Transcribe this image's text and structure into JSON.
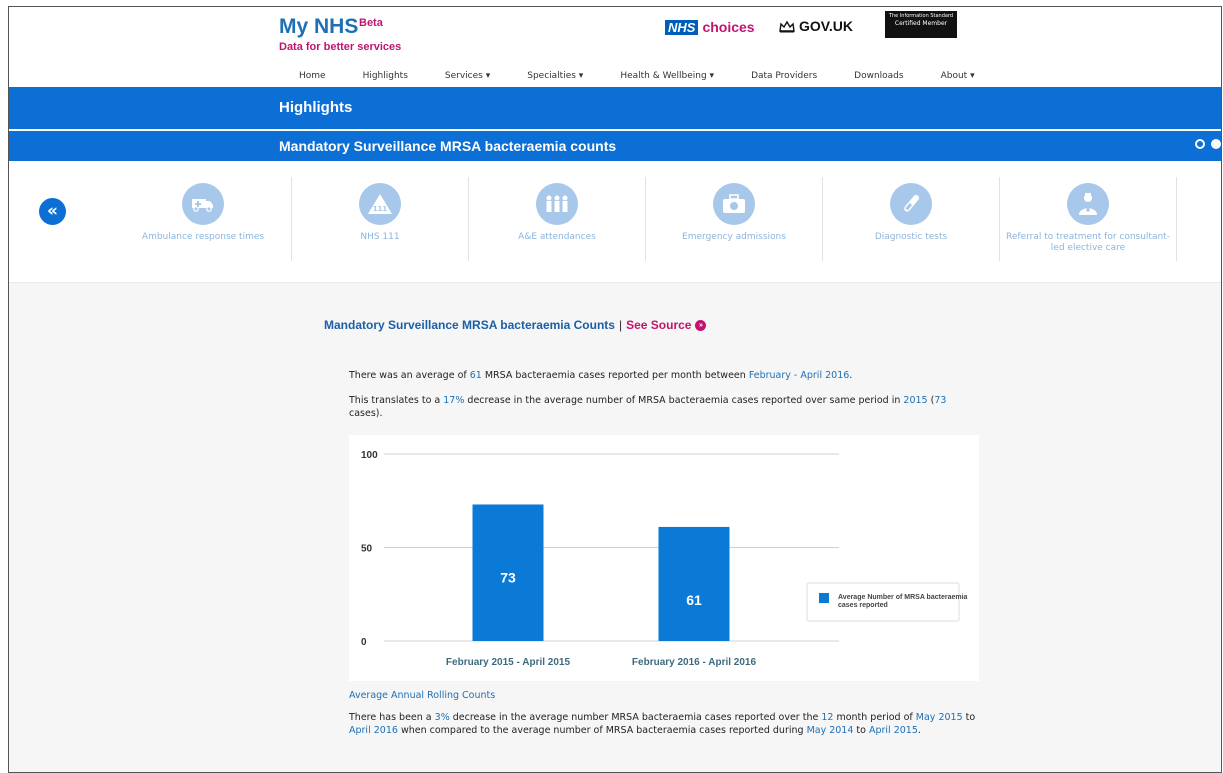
{
  "header": {
    "brand_title": "My NHS",
    "brand_beta": "Beta",
    "brand_subtitle": "Data for better services",
    "partners": {
      "nhs_box": "NHS",
      "nhs_choices": "choices",
      "gov": "GOV.UK",
      "info_standard_line1": "The Information Standard",
      "info_standard_line2": "Certified Member"
    }
  },
  "nav": {
    "items": [
      "Home",
      "Highlights",
      "Services ▾",
      "Specialties ▾",
      "Health & Wellbeing ▾",
      "Data Providers",
      "Downloads",
      "About ▾"
    ]
  },
  "highlights_bar": {
    "title": "Highlights"
  },
  "title_bar": {
    "title": "Mandatory Surveillance MRSA bacteraemia counts"
  },
  "carousel": {
    "items": [
      {
        "label": "Ambulance response times",
        "icon": "ambulance-icon"
      },
      {
        "label": "NHS 111",
        "icon": "nhs111-icon"
      },
      {
        "label": "A&E attendances",
        "icon": "people-icon"
      },
      {
        "label": "Emergency admissions",
        "icon": "medical-kit-icon"
      },
      {
        "label": "Diagnostic tests",
        "icon": "test-tube-icon"
      },
      {
        "label": "Referral to treatment for consultant-led elective care",
        "icon": "doctor-icon"
      }
    ]
  },
  "main": {
    "section_title": "Mandatory Surveillance MRSA bacteraemia Counts",
    "separator": "|",
    "source_link": "See Source",
    "para1": {
      "a": "There was an average of ",
      "value": "61",
      "b": " MRSA bacteraemia cases reported per month between ",
      "period": "February - April 2016",
      "c": "."
    },
    "para2": {
      "a": "This translates to a ",
      "pct": "17%",
      "b": " decrease in the average number of MRSA bacteraemia cases reported over same period in ",
      "year": "2015",
      "c": " (",
      "cases": "73",
      "d": " cases)."
    },
    "rolling_heading": "Average Annual Rolling Counts",
    "para4": {
      "a": "There has been a ",
      "pct": "3%",
      "b": " decrease in the average number MRSA bacteraemia cases reported over the ",
      "months": "12",
      "c": " month period of ",
      "from": "May 2015",
      "d": " to ",
      "to": "April 2016",
      "e": " when compared to the average number of MRSA bacteraemia cases reported during ",
      "from2": "May 2014",
      "f": " to ",
      "to2": "April 2015",
      "g": "."
    }
  },
  "chart_data": {
    "type": "bar",
    "categories": [
      "February 2015 - April 2015",
      "February 2016 - April 2016"
    ],
    "series": [
      {
        "name": "Average Number of MRSA bacteraemia cases reported",
        "values": [
          73,
          61
        ]
      }
    ],
    "data_labels": [
      "73",
      "61"
    ],
    "ylim": [
      0,
      100
    ],
    "yticks": [
      0,
      50,
      100
    ],
    "grid": true,
    "legend_position": "right",
    "bar_color": "#0b7ad6"
  }
}
